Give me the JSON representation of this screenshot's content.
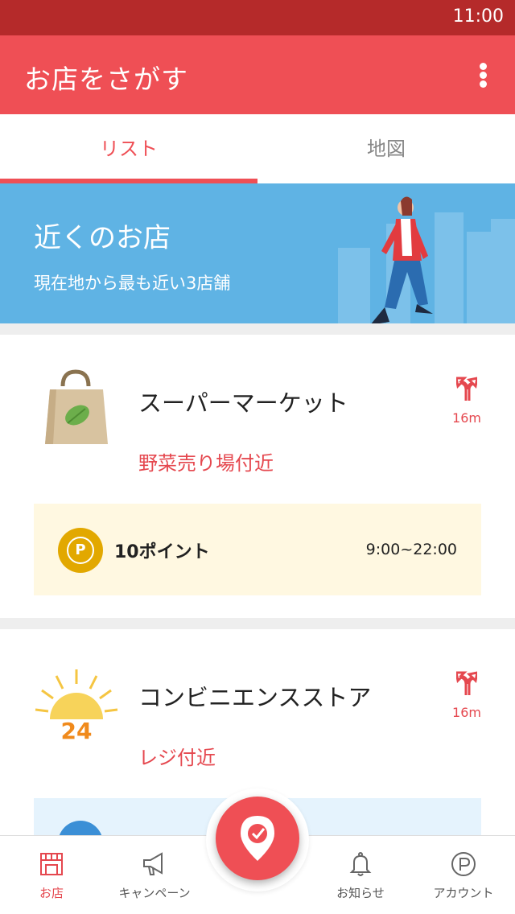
{
  "status_bar": {
    "time": "11:00"
  },
  "app_bar": {
    "title": "お店をさがす",
    "menu_icon": "more-vert-icon"
  },
  "tabs": [
    {
      "label": "リスト",
      "active": true
    },
    {
      "label": "地図",
      "active": false
    }
  ],
  "banner": {
    "title": "近くのお店",
    "subtitle": "現在地から最も近い3店舗"
  },
  "stores": [
    {
      "name": "スーパーマーケット",
      "location": "野菜売り場付近",
      "distance": "16m",
      "icon": "shopping-bag-icon",
      "points": "10ポイント",
      "hours": "9:00~22:00"
    },
    {
      "name": "コンビニエンスストア",
      "location": "レジ付近",
      "distance": "16m",
      "icon": "sun-24-icon",
      "icon_text": "24"
    }
  ],
  "bottom_nav": [
    {
      "label": "お店",
      "icon": "store-icon",
      "active": true
    },
    {
      "label": "キャンペーン",
      "icon": "megaphone-icon",
      "active": false
    },
    {
      "label": "お知らせ",
      "icon": "bell-icon",
      "active": false
    },
    {
      "label": "アカウント",
      "icon": "point-p-icon",
      "active": false
    }
  ],
  "colors": {
    "primary": "#ef4f55",
    "status_bar": "#b52a2a",
    "banner": "#5fb3e4",
    "info_bg": "#fff8e1",
    "point_badge": "#e2a800"
  }
}
